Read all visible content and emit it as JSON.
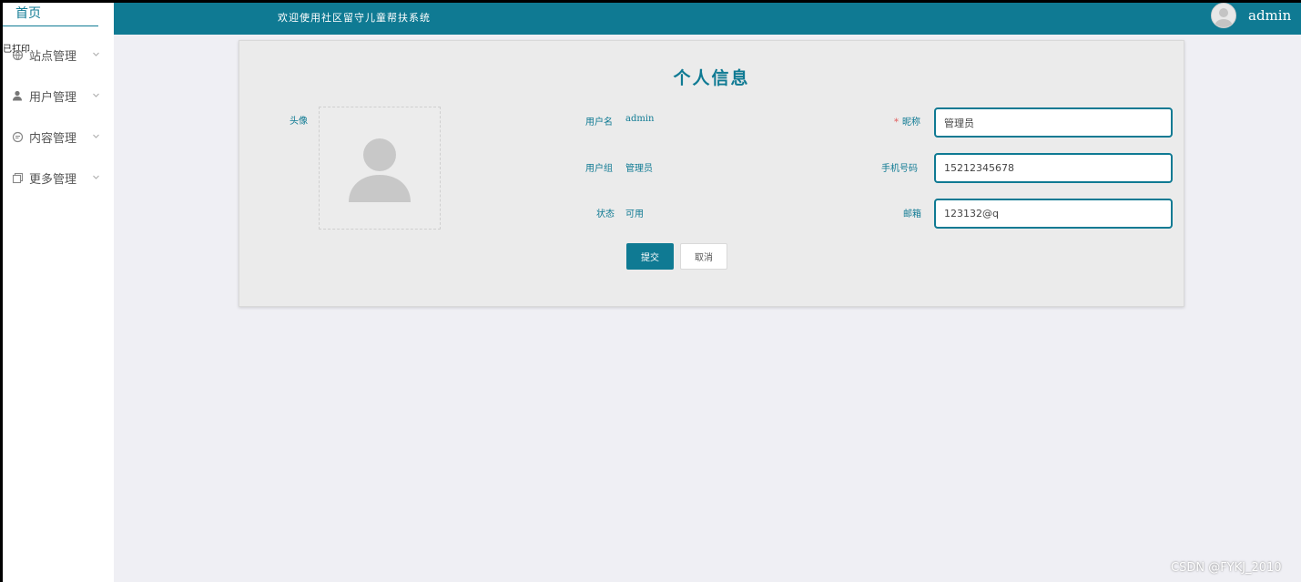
{
  "sidebar": {
    "home_label": "首页",
    "overlay_text": "已打印",
    "items": [
      {
        "label": "站点管理",
        "icon": "site-icon"
      },
      {
        "label": "用户管理",
        "icon": "user-icon"
      },
      {
        "label": "内容管理",
        "icon": "chat-icon"
      },
      {
        "label": "更多管理",
        "icon": "copy-icon"
      }
    ]
  },
  "header": {
    "welcome_text": "欢迎使用社区留守儿童帮扶系统",
    "username": "admin"
  },
  "profile": {
    "title": "个人信息",
    "avatar_label": "头像",
    "username_label": "用户名",
    "username_value": "admin",
    "group_label": "用户组",
    "group_value": "管理员",
    "status_label": "状态",
    "status_value": "可用",
    "nickname_required_mark": "*",
    "nickname_label": "昵称",
    "nickname_value": "管理员",
    "phone_label": "手机号码",
    "phone_value": "15212345678",
    "email_label": "邮箱",
    "email_value": "123132@q",
    "submit_label": "提交",
    "cancel_label": "取消"
  },
  "watermark": "CSDN @FYKJ_2010",
  "colors": {
    "primary": "#0f7a93",
    "background": "#efeff4",
    "required": "#e05a5a"
  }
}
